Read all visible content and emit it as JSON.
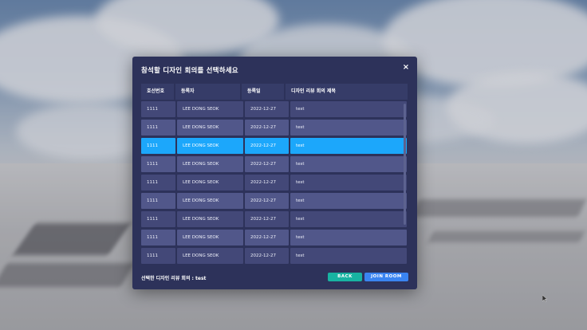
{
  "modal": {
    "title": "참석할 디자인 회의를 선택하세요",
    "close_glyph": "×"
  },
  "table": {
    "headers": [
      "호선번호",
      "등록자",
      "등록일",
      "디자인 리뷰 회의 제목"
    ],
    "rows": [
      {
        "ship_no": "1111",
        "registrant": "LEE DONG SEOK",
        "date": "2022-12-27",
        "title": "test",
        "selected": false
      },
      {
        "ship_no": "1111",
        "registrant": "LEE DONG SEOK",
        "date": "2022-12-27",
        "title": "test",
        "selected": false
      },
      {
        "ship_no": "1111",
        "registrant": "LEE DONG SEOK",
        "date": "2022-12-27",
        "title": "test",
        "selected": true
      },
      {
        "ship_no": "1111",
        "registrant": "LEE DONG SEOK",
        "date": "2022-12-27",
        "title": "test",
        "selected": false
      },
      {
        "ship_no": "1111",
        "registrant": "LEE DONG SEOK",
        "date": "2022-12-27",
        "title": "test",
        "selected": false
      },
      {
        "ship_no": "1111",
        "registrant": "LEE DONG SEOK",
        "date": "2022-12-27",
        "title": "test",
        "selected": false
      },
      {
        "ship_no": "1111",
        "registrant": "LEE DONG SEOK",
        "date": "2022-12-27",
        "title": "test",
        "selected": false
      },
      {
        "ship_no": "1111",
        "registrant": "LEE DONG SEOK",
        "date": "2022-12-27",
        "title": "test",
        "selected": false
      },
      {
        "ship_no": "1111",
        "registrant": "LEE DONG SEOK",
        "date": "2022-12-27",
        "title": "test",
        "selected": false
      }
    ]
  },
  "footer": {
    "selected_label": "선택한 디자인 리뷰 회의 : test",
    "back_label": "BACK",
    "join_label": "JOIN ROOM"
  },
  "colors": {
    "modal_bg": "#2d325a",
    "row_bg": "#474c7b",
    "selected_row": "#1ca7fb",
    "back_button": "#18b3a2",
    "join_button": "#3a84f0"
  },
  "icons": {
    "close": "close-icon",
    "cursor": "mouse-cursor-icon"
  }
}
